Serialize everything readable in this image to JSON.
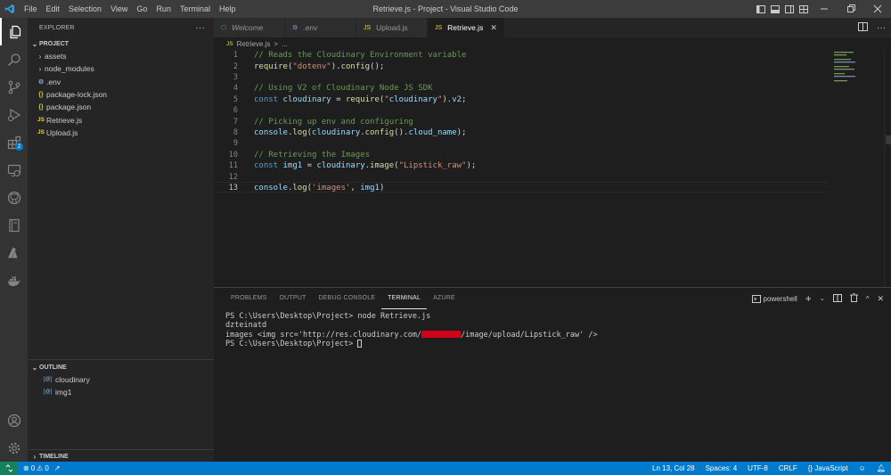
{
  "window": {
    "title": "Retrieve.js - Project - Visual Studio Code",
    "menu": [
      "File",
      "Edit",
      "Selection",
      "View",
      "Go",
      "Run",
      "Terminal",
      "Help"
    ]
  },
  "activity_bar": {
    "items": [
      "explorer-icon",
      "search-icon",
      "source-control-icon",
      "run-debug-icon",
      "extensions-icon",
      "remote-explorer-icon",
      "github-icon",
      "notebook-icon",
      "azure-icon",
      "docker-icon"
    ],
    "extensions_badge": "2",
    "bottom": [
      "account-icon",
      "settings-gear-icon"
    ]
  },
  "sidebar": {
    "header": "EXPLORER",
    "project_label": "PROJECT",
    "tree": [
      {
        "name": "assets",
        "type": "folder"
      },
      {
        "name": "node_modules",
        "type": "folder"
      },
      {
        "name": ".env",
        "type": "env"
      },
      {
        "name": "package-lock.json",
        "type": "json"
      },
      {
        "name": "package.json",
        "type": "json"
      },
      {
        "name": "Retrieve.js",
        "type": "js"
      },
      {
        "name": "Upload.js",
        "type": "js"
      }
    ],
    "outline_label": "OUTLINE",
    "outline": [
      "cloudinary",
      "img1"
    ],
    "timeline_label": "TIMELINE"
  },
  "tabs": [
    {
      "label": "Welcome",
      "icon": "VS",
      "italic": true,
      "active": false
    },
    {
      "label": ".env",
      "icon": "⚙",
      "italic": true,
      "active": false
    },
    {
      "label": "Upload.js",
      "icon": "JS",
      "italic": false,
      "active": false
    },
    {
      "label": "Retrieve.js",
      "icon": "JS",
      "italic": false,
      "active": true
    }
  ],
  "breadcrumb": {
    "js_badge": "JS",
    "file": "Retrieve.js",
    "sep": ">",
    "tail": "..."
  },
  "editor": {
    "lines": [
      {
        "n": "1",
        "text": "// Reads the Cloudinary Environment variable"
      },
      {
        "n": "2",
        "text": "require(\"dotenv\").config();"
      },
      {
        "n": "3",
        "text": ""
      },
      {
        "n": "4",
        "text": "// Using V2 of Cloudinary Node JS SDK"
      },
      {
        "n": "5",
        "text": "const cloudinary = require(\"cloudinary\").v2;"
      },
      {
        "n": "6",
        "text": ""
      },
      {
        "n": "7",
        "text": "// Picking up env and configuring"
      },
      {
        "n": "8",
        "text": "console.log(cloudinary.config().cloud_name);"
      },
      {
        "n": "9",
        "text": ""
      },
      {
        "n": "10",
        "text": "// Retrieving the Images"
      },
      {
        "n": "11",
        "text": "const img1 = cloudinary.image(\"Lipstick_raw\");"
      },
      {
        "n": "12",
        "text": ""
      },
      {
        "n": "13",
        "text": "console.log('images', img1)"
      }
    ],
    "current_line": "13"
  },
  "panel": {
    "tabs": [
      "PROBLEMS",
      "OUTPUT",
      "DEBUG CONSOLE",
      "TERMINAL",
      "AZURE"
    ],
    "active_tab": "TERMINAL",
    "shell": "powershell",
    "terminal": {
      "line1": "PS C:\\Users\\Desktop\\Project> node Retrieve.js",
      "line2": "dzteinatd",
      "line3_pre": "images <img src='http://res.cloudinary.com/",
      "line3_post": "/image/upload/Lipstick_raw' />",
      "line4": "PS C:\\Users\\Desktop\\Project> "
    }
  },
  "status_bar": {
    "errors": "0",
    "warnings": "0",
    "position": "Ln 13, Col 28",
    "spaces": "Spaces: 4",
    "encoding": "UTF-8",
    "eol": "CRLF",
    "language_braces": "{}",
    "language": "JavaScript"
  },
  "colors": {
    "accent": "#007acc",
    "remote": "#16825d",
    "redaction": "#d0021b"
  }
}
